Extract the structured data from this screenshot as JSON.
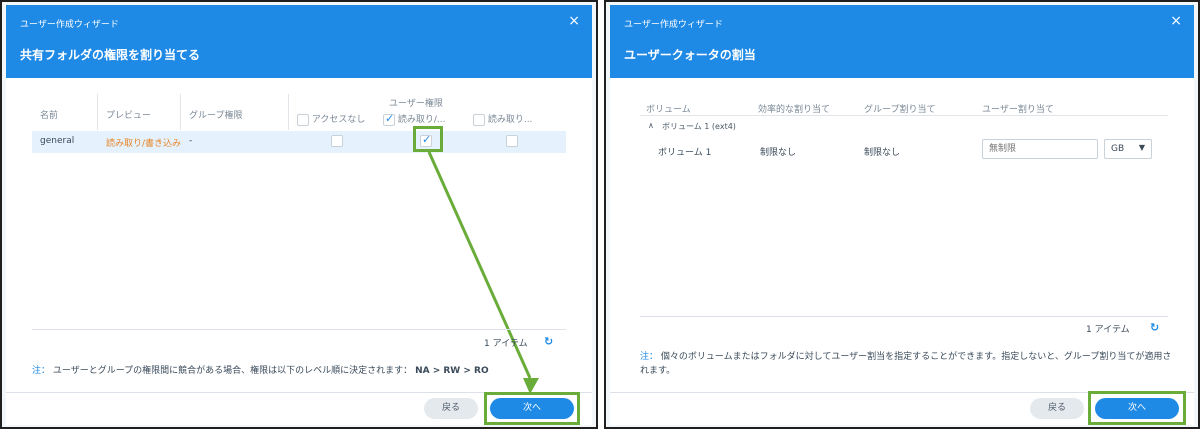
{
  "left": {
    "wizard_title": "ユーザー作成ウィザード",
    "close": "×",
    "step_title": "共有フォルダの権限を割り当てる",
    "columns": {
      "name": "名前",
      "preview": "プレビュー",
      "group_perm": "グループ権限",
      "user_perm": "ユーザー権限",
      "no_access": "アクセスなし",
      "read_write": "読み取り/...",
      "read_only": "読み取り..."
    },
    "row": {
      "name": "general",
      "preview": "読み取り/書き込み",
      "group_perm": "-"
    },
    "count": "1 アイテム",
    "note_label": "注：",
    "note_text": "ユーザーとグループの権限間に競合がある場合、権限は以下のレベル順に決定されます：",
    "note_levels": "NA > RW > RO",
    "back": "戻る",
    "next": "次へ"
  },
  "right": {
    "wizard_title": "ユーザー作成ウィザード",
    "close": "×",
    "step_title": "ユーザークォータの割当",
    "columns": {
      "volume": "ボリューム",
      "effective": "効率的な割り当て",
      "group_quota": "グループ割り当て",
      "user_quota": "ユーザー割り当て"
    },
    "group_label": "ボリューム 1 (ext4)",
    "row": {
      "volume": "ボリューム 1",
      "effective": "制限なし",
      "group_quota": "制限なし",
      "user_quota_placeholder": "無制限",
      "unit": "GB"
    },
    "count": "1 アイテム",
    "note_label": "注：",
    "note_text": "個々のボリュームまたはフォルダに対してユーザー割当を指定することができます。指定しないと、グループ割り当てが適用されます。",
    "back": "戻る",
    "next": "次へ"
  },
  "colors": {
    "accent": "#1f8ae6",
    "highlight": "#6aac3a",
    "preview_text": "#e8862a"
  }
}
